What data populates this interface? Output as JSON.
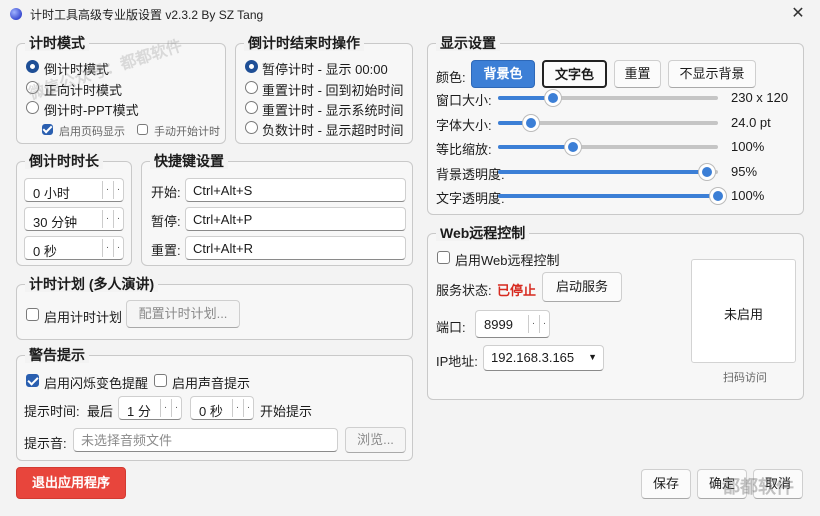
{
  "window": {
    "title": "计时工具高级专业版设置 v2.3.2 By SZ Tang",
    "close_glyph": "✕"
  },
  "watermark": {
    "top": "微信公众号：都都软件",
    "bottom": "都都软件"
  },
  "timer_mode": {
    "title": "计时模式",
    "options": [
      "倒计时模式",
      "正向计时模式",
      "倒计时-PPT模式"
    ],
    "selected": 0,
    "ppt_page_label": "启用页码显示",
    "manual_start_label": "手动开始计时"
  },
  "end_action": {
    "title": "倒计时结束时操作",
    "options": [
      "暂停计时 - 显示 00:00",
      "重置计时 - 回到初始时间",
      "重置计时 - 显示系统时间",
      "负数计时 - 显示超时时间"
    ],
    "selected": 0
  },
  "duration": {
    "title": "倒计时时长",
    "hours": "0 小时",
    "minutes": "30 分钟",
    "seconds": "0 秒"
  },
  "shortcuts": {
    "title": "快捷键设置",
    "start_label": "开始:",
    "start_value": "Ctrl+Alt+S",
    "pause_label": "暂停:",
    "pause_value": "Ctrl+Alt+P",
    "reset_label": "重置:",
    "reset_value": "Ctrl+Alt+R"
  },
  "plan": {
    "title": "计时计划 (多人演讲)",
    "enable_label": "启用计时计划",
    "config_button": "配置计时计划..."
  },
  "warning": {
    "title": "警告提示",
    "flash_label": "启用闪烁变色提醒",
    "sound_label": "启用声音提示",
    "time_label": "提示时间:",
    "last_label": "最后",
    "min_value": "1 分",
    "sec_value": "0 秒",
    "start_prompt": "开始提示",
    "sound_file_label": "提示音:",
    "sound_file_placeholder": "未选择音频文件",
    "browse_button": "浏览..."
  },
  "display": {
    "title": "显示设置",
    "color_label": "颜色:",
    "bg_button": "背景色",
    "text_button": "文字色",
    "reset_button": "重置",
    "hide_bg_button": "不显示背景",
    "sliders": [
      {
        "label": "窗口大小:",
        "value": "230 x 120",
        "fraction": 0.25
      },
      {
        "label": "字体大小:",
        "value": "24.0 pt",
        "fraction": 0.15
      },
      {
        "label": "等比缩放:",
        "value": "100%",
        "fraction": 0.34
      },
      {
        "label": "背景透明度:",
        "value": "95%",
        "fraction": 0.95
      },
      {
        "label": "文字透明度:",
        "value": "100%",
        "fraction": 1.0
      }
    ],
    "accent_color": "#3c7fd6"
  },
  "web": {
    "title": "Web远程控制",
    "enable_label": "启用Web远程控制",
    "status_label": "服务状态:",
    "status_value": "已停止",
    "start_service_button": "启动服务",
    "port_label": "端口:",
    "port_value": "8999",
    "ip_label": "IP地址:",
    "ip_value": "192.168.3.165",
    "qr_status": "未启用",
    "qr_caption": "扫码访问"
  },
  "footer": {
    "exit_button": "退出应用程序",
    "save_button": "保存",
    "ok_button": "确定",
    "cancel_button": "取消"
  }
}
